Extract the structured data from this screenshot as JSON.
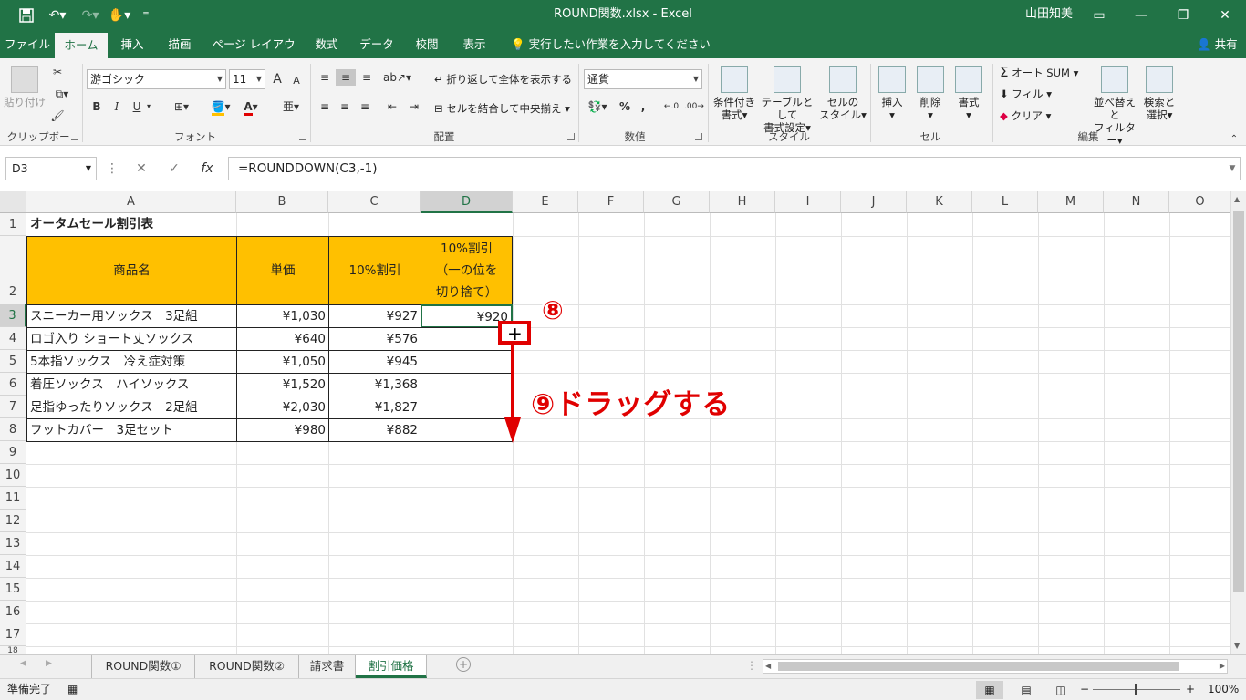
{
  "titlebar": {
    "filename": "ROUND関数.xlsx",
    "sep": "-",
    "app": "Excel",
    "user": "山田知美"
  },
  "tabs": [
    "ファイル",
    "ホーム",
    "挿入",
    "描画",
    "ページ レイアウト",
    "数式",
    "データ",
    "校閲",
    "表示"
  ],
  "tell_me": "実行したい作業を入力してください",
  "share": "共有",
  "ribbon": {
    "clipboard": {
      "label": "クリップボード",
      "paste": "貼り付け"
    },
    "font": {
      "label": "フォント",
      "name": "游ゴシック",
      "size": "11",
      "bold": "B",
      "italic": "I",
      "underline": "U",
      "grow": "A",
      "shrink": "A",
      "color_a": "A"
    },
    "alignment": {
      "label": "配置",
      "wrap": "折り返して全体を表示する",
      "merge": "セルを結合して中央揃え"
    },
    "number": {
      "label": "数値",
      "format": "通貨",
      "percent": "%",
      "comma": ","
    },
    "styles": {
      "label": "スタイル",
      "cond": [
        "条件付き",
        "書式"
      ],
      "table": [
        "テーブルとして",
        "書式設定"
      ],
      "cell": [
        "セルの",
        "スタイル"
      ]
    },
    "cells": {
      "label": "セル",
      "insert": "挿入",
      "delete": "削除",
      "format": "書式"
    },
    "editing": {
      "label": "編集",
      "autosum": "オート SUM",
      "fill": "フィル",
      "clear": "クリア",
      "sort": [
        "並べ替えと",
        "フィルター"
      ],
      "find": [
        "検索と",
        "選択"
      ]
    }
  },
  "formula_bar": {
    "name_box": "D3",
    "fx": "fx",
    "formula": "=ROUNDDOWN(C3,-1)"
  },
  "columns": [
    "A",
    "B",
    "C",
    "D",
    "E",
    "F",
    "G",
    "H",
    "I",
    "J",
    "K",
    "L",
    "M",
    "N",
    "O"
  ],
  "rows": [
    "1",
    "2",
    "3",
    "4",
    "5",
    "6",
    "7",
    "8",
    "9",
    "10",
    "11",
    "12",
    "13",
    "14",
    "15",
    "16",
    "17",
    "18"
  ],
  "sheet": {
    "title": "オータムセール割引表",
    "headers": {
      "a": "商品名",
      "b": "単価",
      "c": "10%割引",
      "d": [
        "10%割引",
        "（一の位を",
        "切り捨て）"
      ]
    },
    "data": [
      {
        "name": "スニーカー用ソックス　3足組",
        "price": "¥1,030",
        "disc": "¥927",
        "round": "¥920"
      },
      {
        "name": "ロゴ入り ショート丈ソックス",
        "price": "¥640",
        "disc": "¥576",
        "round": ""
      },
      {
        "name": "5本指ソックス　冷え症対策",
        "price": "¥1,050",
        "disc": "¥945",
        "round": ""
      },
      {
        "name": "着圧ソックス　ハイソックス",
        "price": "¥1,520",
        "disc": "¥1,368",
        "round": ""
      },
      {
        "name": "足指ゆったりソックス　2足組",
        "price": "¥2,030",
        "disc": "¥1,827",
        "round": ""
      },
      {
        "name": "フットカバー　3足セット",
        "price": "¥980",
        "disc": "¥882",
        "round": ""
      }
    ]
  },
  "annotations": {
    "step8": "⑧",
    "step9": "⑨ドラッグする"
  },
  "sheet_tabs": [
    "ROUND関数①",
    "ROUND関数②",
    "請求書",
    "割引価格"
  ],
  "status": {
    "ready": "準備完了",
    "zoom": "100%"
  }
}
